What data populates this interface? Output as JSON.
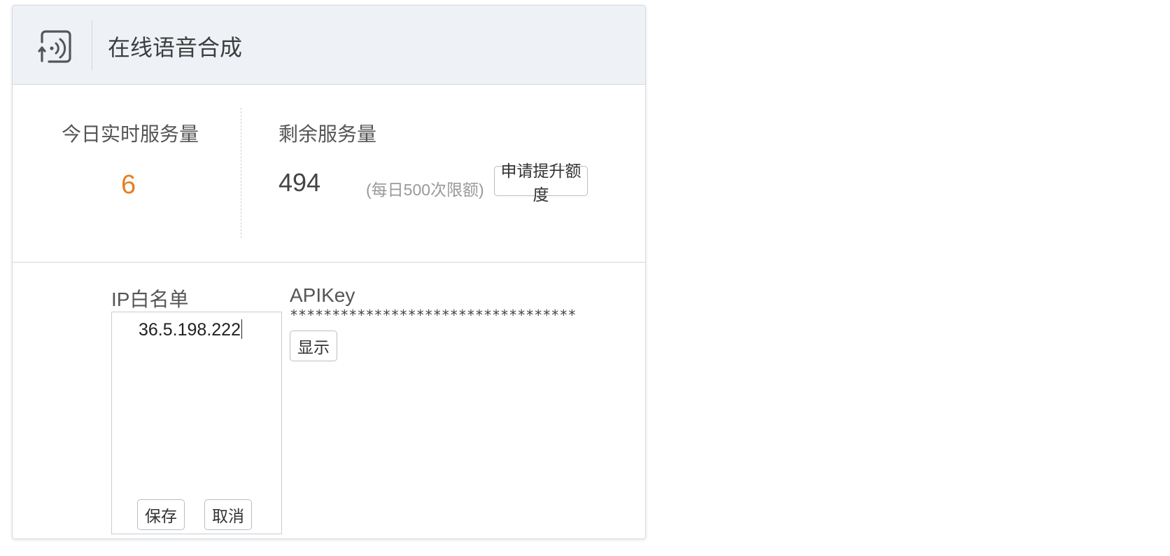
{
  "header": {
    "icon": "speaker-waves-icon",
    "title": "在线语音合成"
  },
  "stats": {
    "today_label": "今日实时服务量",
    "today_value": "6",
    "remaining_label": "剩余服务量",
    "remaining_value": "494",
    "limit_note": "(每日500次限额)",
    "increase_button": "申请提升额度"
  },
  "ip_whitelist": {
    "label": "IP白名单",
    "value": "36.5.198.222",
    "save_button": "保存",
    "cancel_button": "取消"
  },
  "apikey": {
    "label": "APIKey",
    "masked_value": "**********************************",
    "show_button": "显示"
  },
  "colors": {
    "header_bg": "#eef2f7",
    "accent_orange": "#e67e22",
    "border": "#d2d7de"
  }
}
